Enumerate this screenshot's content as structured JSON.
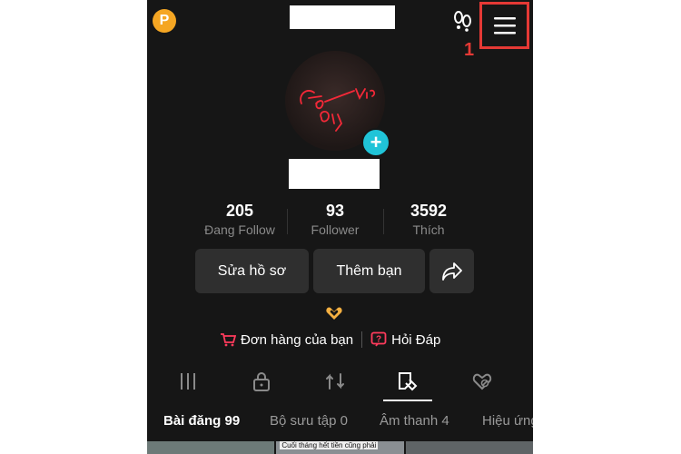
{
  "header": {
    "coin_label": "P",
    "annotation_number": "1"
  },
  "avatar": {
    "neon_text": "Good Vibes Only"
  },
  "stats": [
    {
      "value": "205",
      "label": "Đang Follow"
    },
    {
      "value": "93",
      "label": "Follower"
    },
    {
      "value": "3592",
      "label": "Thích"
    }
  ],
  "actions": {
    "edit_profile": "Sửa hồ sơ",
    "add_friend": "Thêm bạn"
  },
  "links": {
    "orders": "Đơn hàng của bạn",
    "faq": "Hỏi Đáp"
  },
  "subtabs": [
    "Bài đăng 99",
    "Bộ sưu tập 0",
    "Âm thanh 4",
    "Hiệu ứng"
  ],
  "thumb_caption": "Cuối tháng hết tiền cũng phải",
  "colors": {
    "screen_bg": "#161616",
    "accent_red": "#e53935",
    "add_button": "#20c4d8",
    "coin": "#f5a623"
  },
  "icons": [
    "coin-icon",
    "footprints-icon",
    "menu-icon",
    "plus-icon",
    "share-icon",
    "heart-hands-icon",
    "cart-icon",
    "question-icon",
    "grid-icon",
    "lock-icon",
    "repost-icon",
    "tag-icon",
    "liked-icon"
  ]
}
